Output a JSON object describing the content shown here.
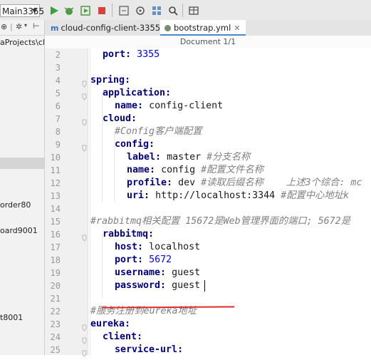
{
  "toolbar": {
    "run_config": "Main3355",
    "colors": {
      "run": "#3aa03a",
      "stop": "#d9413b"
    }
  },
  "left_panel": {
    "path_text": "aProjects\\clou",
    "items": [
      "order80",
      "oard9001",
      "t8001"
    ]
  },
  "tabs": [
    {
      "label": "cloud-config-client-3355",
      "active": false
    },
    {
      "label": "bootstrap.yml",
      "active": true
    }
  ],
  "editor": {
    "breadcrumb": "Document 1/1",
    "lines": [
      {
        "n": "2",
        "indent": 1,
        "key": "port",
        "value": "3355",
        "value_type": "num",
        "comment": ""
      },
      {
        "n": "3",
        "indent": 0,
        "key": "",
        "value": "",
        "value_type": "",
        "comment": ""
      },
      {
        "n": "4",
        "indent": 0,
        "key": "spring",
        "value": "",
        "value_type": "",
        "comment": ""
      },
      {
        "n": "5",
        "indent": 1,
        "key": "application",
        "value": "",
        "value_type": "",
        "comment": ""
      },
      {
        "n": "6",
        "indent": 2,
        "key": "name",
        "value": "config-client",
        "value_type": "str",
        "comment": ""
      },
      {
        "n": "7",
        "indent": 1,
        "key": "cloud",
        "value": "",
        "value_type": "",
        "comment": ""
      },
      {
        "n": "8",
        "indent": 2,
        "key": "",
        "value": "",
        "value_type": "",
        "comment": "#Config客户端配置"
      },
      {
        "n": "9",
        "indent": 2,
        "key": "config",
        "value": "",
        "value_type": "",
        "comment": ""
      },
      {
        "n": "10",
        "indent": 3,
        "key": "label",
        "value": "master",
        "value_type": "str",
        "comment": "#分支名称"
      },
      {
        "n": "11",
        "indent": 3,
        "key": "name",
        "value": "config",
        "value_type": "str",
        "comment": "#配置文件名称"
      },
      {
        "n": "12",
        "indent": 3,
        "key": "profile",
        "value": "dev",
        "value_type": "str",
        "comment": "#读取后缀名称    上述3个综合: mc"
      },
      {
        "n": "13",
        "indent": 3,
        "key": "uri",
        "value": "http://localhost:3344",
        "value_type": "str",
        "comment": "#配置中心地址k"
      },
      {
        "n": "14",
        "indent": 0,
        "key": "",
        "value": "",
        "value_type": "",
        "comment": ""
      },
      {
        "n": "15",
        "indent": 0,
        "key": "",
        "value": "",
        "value_type": "",
        "comment": "#rabbitmq相关配置 15672是Web管理界面的端口; 5672是"
      },
      {
        "n": "16",
        "indent": 1,
        "key": "rabbitmq",
        "value": "",
        "value_type": "",
        "comment": ""
      },
      {
        "n": "17",
        "indent": 2,
        "key": "host",
        "value": "localhost",
        "value_type": "str",
        "comment": ""
      },
      {
        "n": "18",
        "indent": 2,
        "key": "port",
        "value": "5672",
        "value_type": "num",
        "comment": ""
      },
      {
        "n": "19",
        "indent": 2,
        "key": "username",
        "value": "guest",
        "value_type": "str",
        "comment": ""
      },
      {
        "n": "20",
        "indent": 2,
        "key": "password",
        "value": "guest",
        "value_type": "str",
        "comment": ""
      },
      {
        "n": "21",
        "indent": 0,
        "key": "",
        "value": "",
        "value_type": "",
        "comment": ""
      },
      {
        "n": "22",
        "indent": 0,
        "key": "",
        "value": "",
        "value_type": "",
        "comment": "#服务注册到eureka地址"
      },
      {
        "n": "23",
        "indent": 0,
        "key": "eureka",
        "value": "",
        "value_type": "",
        "comment": ""
      },
      {
        "n": "24",
        "indent": 1,
        "key": "client",
        "value": "",
        "value_type": "",
        "comment": ""
      },
      {
        "n": "25",
        "indent": 2,
        "key": "service-url",
        "value": "",
        "value_type": "",
        "comment": ""
      }
    ]
  }
}
